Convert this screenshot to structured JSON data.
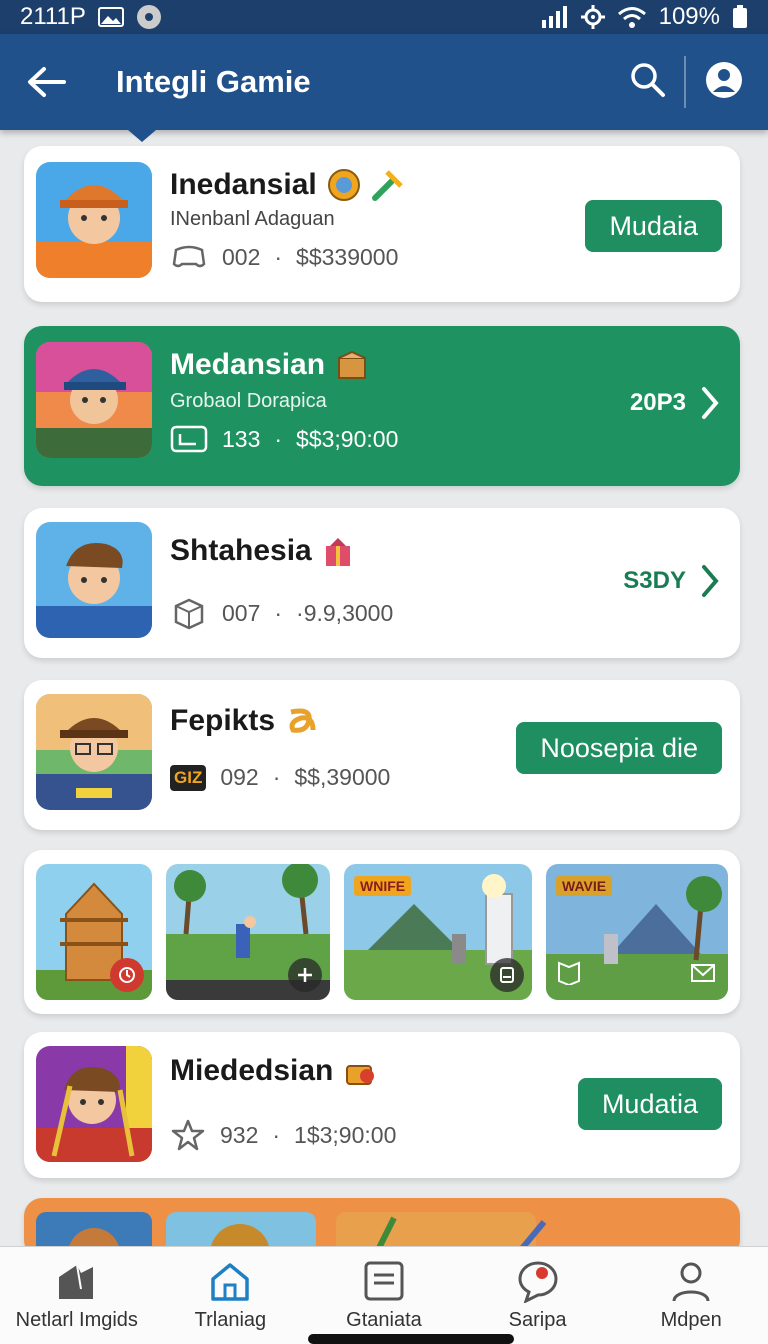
{
  "status_bar": {
    "time": "2111P",
    "battery": "109%"
  },
  "app_bar": {
    "title": "Integli Gamie"
  },
  "items": [
    {
      "title": "Inedansial",
      "subtitle": "INenbanl Adaguan",
      "meta_num": "002",
      "meta_price": "$$339000",
      "button": "Mudaia"
    },
    {
      "title": "Medansian",
      "subtitle": "Grobaol Dorapica",
      "meta_num": "133",
      "meta_price": "$$3;90:00",
      "link": "20P3"
    },
    {
      "title": "Shtahesia",
      "meta_num": "007",
      "meta_price": "·9.9,3000",
      "link": "S3DY"
    },
    {
      "title": "Fepikts",
      "meta_badge": "GIZ",
      "meta_num": "092",
      "meta_price": "$$,39000",
      "button": "Noosepia die"
    },
    {
      "title": "Miededsian",
      "meta_num": "932",
      "meta_price": "1$3;90:00",
      "button": "Mudatia"
    }
  ],
  "gallery": {
    "banners": [
      "WNIFE",
      "WAVIE"
    ]
  },
  "bottom_nav": [
    {
      "label": "Netlarl Imgids",
      "icon": "mountain-icon"
    },
    {
      "label": "Trlaniag",
      "icon": "home-icon"
    },
    {
      "label": "Gtaniata",
      "icon": "list-icon"
    },
    {
      "label": "Saripa",
      "icon": "chat-icon"
    },
    {
      "label": "Mdpen",
      "icon": "profile-icon"
    }
  ],
  "colors": {
    "app_bar": "#21518a",
    "accent_green": "#1f9261",
    "background": "#e9eaec"
  }
}
